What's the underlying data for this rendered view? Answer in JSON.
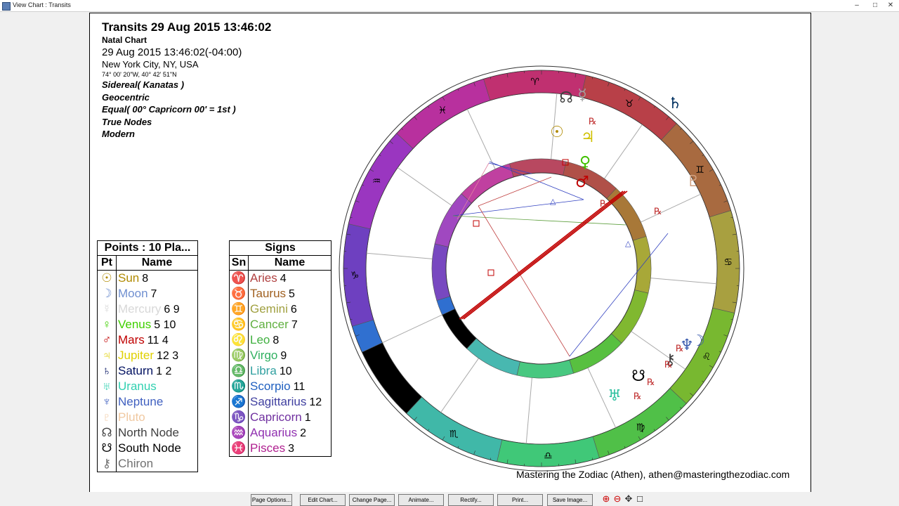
{
  "window": {
    "title": "View Chart : Transits",
    "minimize": "–",
    "maximize": "□",
    "close": "✕"
  },
  "header": {
    "title": "Transits 29 Aug 2015 13:46:02",
    "subtitle": "Natal Chart",
    "datetime": "29 Aug 2015 13:46:02(-04:00)",
    "location": "New York City, NY, USA",
    "coords": "74° 00' 20\"W, 40° 42' 51\"N",
    "settings": [
      "Sidereal( Kanatas )",
      "Geocentric",
      "Equal( 00° Capricorn 00' = 1st )",
      "True Nodes",
      "Modern"
    ]
  },
  "points_table": {
    "title": "Points : 10 Pla...",
    "col_pt": "Pt",
    "col_name": "Name",
    "rows": [
      {
        "glyph": "☉",
        "name": "Sun",
        "nums": "8",
        "color": "#b08a00"
      },
      {
        "glyph": "☽",
        "name": "Moon",
        "nums": "7",
        "color": "#6f8fd0"
      },
      {
        "glyph": "☿",
        "name": "Mercury",
        "nums": "6 9",
        "color": "#d8d8d8"
      },
      {
        "glyph": "♀",
        "name": "Venus",
        "nums": "5 10",
        "color": "#3fd000"
      },
      {
        "glyph": "♂",
        "name": "Mars",
        "nums": "11 4",
        "color": "#c00000"
      },
      {
        "glyph": "♃",
        "name": "Jupiter",
        "nums": "12 3",
        "color": "#e0d000"
      },
      {
        "glyph": "♄",
        "name": "Saturn",
        "nums": "1 2",
        "color": "#001060"
      },
      {
        "glyph": "♅",
        "name": "Uranus",
        "nums": "",
        "color": "#30d0b0"
      },
      {
        "glyph": "♆",
        "name": "Neptune",
        "nums": "",
        "color": "#4060c0"
      },
      {
        "glyph": "♇",
        "name": "Pluto",
        "nums": "",
        "color": "#f0c8a0"
      },
      {
        "glyph": "☊",
        "name": "North Node",
        "nums": "",
        "color": "#404040"
      },
      {
        "glyph": "☋",
        "name": "South Node",
        "nums": "",
        "color": "#000000"
      },
      {
        "glyph": "⚷",
        "name": "Chiron",
        "nums": "",
        "color": "#707070"
      }
    ]
  },
  "signs_table": {
    "title": "Signs",
    "col_sn": "Sn",
    "col_name": "Name",
    "rows": [
      {
        "glyph": "♈",
        "name": "Aries",
        "nums": "4",
        "color": "#b04040"
      },
      {
        "glyph": "♉",
        "name": "Taurus",
        "nums": "5",
        "color": "#a06020"
      },
      {
        "glyph": "♊",
        "name": "Gemini",
        "nums": "6",
        "color": "#a0a040"
      },
      {
        "glyph": "♋",
        "name": "Cancer",
        "nums": "7",
        "color": "#60b040"
      },
      {
        "glyph": "♌",
        "name": "Leo",
        "nums": "8",
        "color": "#40b040"
      },
      {
        "glyph": "♍",
        "name": "Virgo",
        "nums": "9",
        "color": "#30b060"
      },
      {
        "glyph": "♎",
        "name": "Libra",
        "nums": "10",
        "color": "#30a0a0"
      },
      {
        "glyph": "♏",
        "name": "Scorpio",
        "nums": "11",
        "color": "#2060c0"
      },
      {
        "glyph": "♐",
        "name": "Sagittarius",
        "nums": "12",
        "color": "#4040a0"
      },
      {
        "glyph": "♑",
        "name": "Capricorn",
        "nums": "1",
        "color": "#7030a0"
      },
      {
        "glyph": "♒",
        "name": "Aquarius",
        "nums": "2",
        "color": "#9030b0"
      },
      {
        "glyph": "♓",
        "name": "Pisces",
        "nums": "3",
        "color": "#b02090"
      }
    ]
  },
  "wheel_glyphs": {
    "signs": [
      "♑",
      "♒",
      "♓",
      "♈",
      "♉",
      "♊",
      "♋",
      "♌",
      "♍",
      "♎",
      "♏",
      "♐"
    ],
    "planets_outer": [
      {
        "glyph": "♄",
        "color": "#003060"
      },
      {
        "glyph": "☿",
        "color": "#a0a0a0"
      },
      {
        "glyph": "☊",
        "color": "#404040"
      },
      {
        "glyph": "☉",
        "color": "#b08a00"
      },
      {
        "glyph": "♃",
        "color": "#d0c000"
      },
      {
        "glyph": "♀",
        "color": "#40c000"
      },
      {
        "glyph": "♂",
        "color": "#c00000"
      },
      {
        "glyph": "♇",
        "color": "#d0a080"
      },
      {
        "glyph": "☽",
        "color": "#4060b0"
      },
      {
        "glyph": "♆",
        "color": "#4060b0"
      },
      {
        "glyph": "⚷",
        "color": "#404040"
      },
      {
        "glyph": "☋",
        "color": "#000000"
      },
      {
        "glyph": "♅",
        "color": "#30c0a0"
      }
    ],
    "retro": "℞"
  },
  "footer": {
    "credit": "Mastering the Zodiac (Athen), athen@masteringthezodiac.com"
  },
  "toolbar": {
    "page_options": "Page Options...",
    "edit_chart": "Edit Chart...",
    "change_page": "Change Page...",
    "animate": "Animate...",
    "rectify": "Rectify...",
    "print": "Print...",
    "save_image": "Save Image..."
  }
}
